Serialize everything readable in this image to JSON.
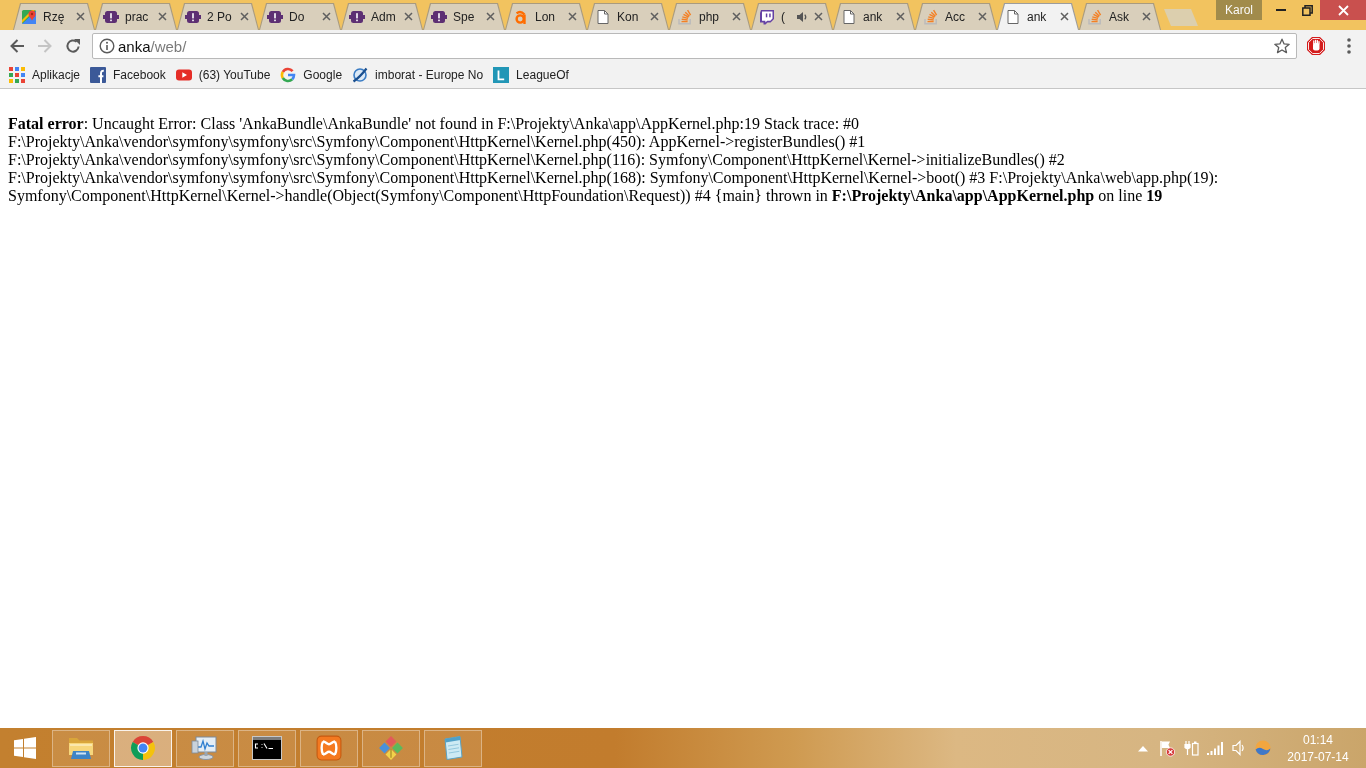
{
  "window": {
    "profile": "Karol"
  },
  "tabs": [
    {
      "title": "Rzę",
      "kind": "map",
      "audio_playing": false,
      "selected": false
    },
    {
      "title": "prac",
      "kind": "ticket",
      "audio_playing": false,
      "selected": false
    },
    {
      "title": "2 Po",
      "kind": "ticket",
      "audio_playing": false,
      "selected": false
    },
    {
      "title": "Do",
      "kind": "ticket",
      "audio_playing": false,
      "selected": false
    },
    {
      "title": "Adm",
      "kind": "ticket",
      "audio_playing": false,
      "selected": false
    },
    {
      "title": "Spe",
      "kind": "ticket",
      "audio_playing": false,
      "selected": false
    },
    {
      "title": "Lon",
      "kind": "letter-a",
      "audio_playing": false,
      "selected": false
    },
    {
      "title": "Kon",
      "kind": "page",
      "audio_playing": false,
      "selected": false
    },
    {
      "title": "php",
      "kind": "stack",
      "audio_playing": false,
      "selected": false
    },
    {
      "title": "(",
      "kind": "twitch",
      "audio_playing": true,
      "selected": false
    },
    {
      "title": "ank",
      "kind": "page",
      "audio_playing": false,
      "selected": false
    },
    {
      "title": "Acc",
      "kind": "stack",
      "audio_playing": false,
      "selected": false
    },
    {
      "title": "ank",
      "kind": "page",
      "audio_playing": false,
      "selected": true
    },
    {
      "title": "Ask",
      "kind": "stack",
      "audio_playing": false,
      "selected": false
    }
  ],
  "navigation": [
    {
      "kind": "back",
      "disabled": false
    },
    {
      "kind": "forward",
      "disabled": true
    },
    {
      "kind": "reload",
      "disabled": false
    }
  ],
  "address_bar": {
    "host": "anka",
    "path": "/web/"
  },
  "bookmarks": [
    {
      "label": "Aplikacje",
      "kind": "apps"
    },
    {
      "label": "Facebook",
      "kind": "f-logo"
    },
    {
      "label": "(63) YouTube",
      "kind": "play-logo"
    },
    {
      "label": "Google",
      "kind": "g-logo"
    },
    {
      "label": "imborat - Europe No",
      "kind": "swirl"
    },
    {
      "label": "LeagueOf",
      "kind": "l-logo"
    }
  ],
  "page": {
    "error": "**Fatal error**: Uncaught Error: Class 'AnkaBundle\\AnkaBundle' not found in F:\\Projekty\\Anka\\app\\AppKernel.php:19 Stack trace: #0 F:\\Projekty\\Anka\\vendor\\symfony\\symfony\\src\\Symfony\\Component\\HttpKernel\\Kernel.php(450): AppKernel->registerBundles() #1 F:\\Projekty\\Anka\\vendor\\symfony\\symfony\\src\\Symfony\\Component\\HttpKernel\\Kernel.php(116): Symfony\\Component\\HttpKernel\\Kernel->initializeBundles() #2 F:\\Projekty\\Anka\\vendor\\symfony\\symfony\\src\\Symfony\\Component\\HttpKernel\\Kernel.php(168): Symfony\\Component\\HttpKernel\\Kernel->boot() #3 F:\\Projekty\\Anka\\web\\app.php(19): Symfony\\Component\\HttpKernel\\Kernel->handle(Object(Symfony\\Component\\HttpFoundation\\Request)) #4 {main} thrown in **F:\\Projekty\\Anka\\app\\AppKernel.php** on line **19**"
  },
  "taskbar": {
    "apps": [
      {
        "kind": "folder",
        "selected": false
      },
      {
        "kind": "browser",
        "selected": true
      },
      {
        "kind": "monitor",
        "selected": false
      },
      {
        "kind": "terminal",
        "selected": false
      },
      {
        "kind": "tile",
        "selected": false
      },
      {
        "kind": "diamonds",
        "selected": false
      },
      {
        "kind": "notepad",
        "selected": false
      }
    ],
    "clock": {
      "time": "01:14",
      "date": "2017-07-14"
    }
  }
}
